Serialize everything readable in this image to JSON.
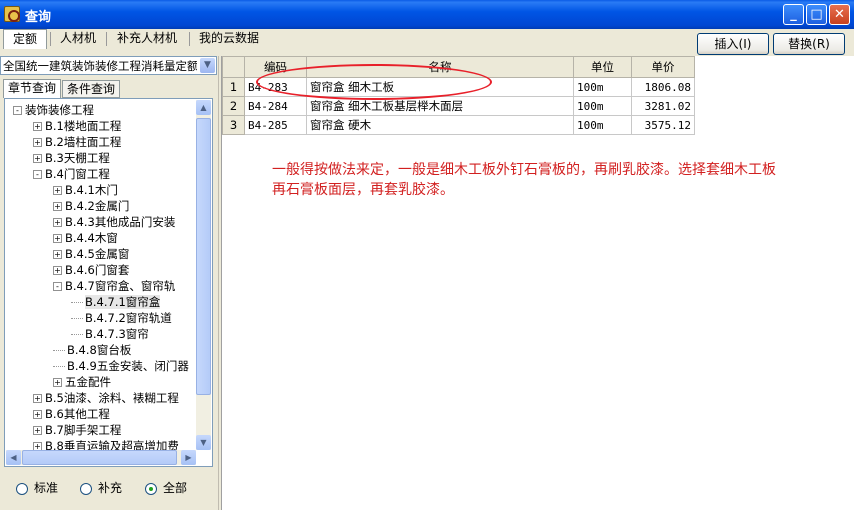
{
  "window": {
    "title": "查询",
    "controls": {
      "minimize": "_",
      "maximize": "□",
      "close": "✕"
    }
  },
  "tabs": [
    "定额",
    "人材机",
    "补充人材机",
    "我的云数据"
  ],
  "buttons": {
    "insert": "插入(I)",
    "replace": "替换(R)"
  },
  "left": {
    "combo_value": "全国统一建筑装饰装修工程消耗量定额",
    "subtabs": [
      "章节查询",
      "条件查询"
    ],
    "tree": [
      {
        "label": "装饰装修工程",
        "level": 0,
        "exp": "-"
      },
      {
        "label": "B.1楼地面工程",
        "level": 1,
        "exp": "+"
      },
      {
        "label": "B.2墙柱面工程",
        "level": 1,
        "exp": "+"
      },
      {
        "label": "B.3天棚工程",
        "level": 1,
        "exp": "+"
      },
      {
        "label": "B.4门窗工程",
        "level": 1,
        "exp": "-"
      },
      {
        "label": "B.4.1木门",
        "level": 2,
        "exp": "+"
      },
      {
        "label": "B.4.2金属门",
        "level": 2,
        "exp": "+"
      },
      {
        "label": "B.4.3其他成品门安装",
        "level": 2,
        "exp": "+"
      },
      {
        "label": "B.4.4木窗",
        "level": 2,
        "exp": "+"
      },
      {
        "label": "B.4.5金属窗",
        "level": 2,
        "exp": "+"
      },
      {
        "label": "B.4.6门窗套",
        "level": 2,
        "exp": "+"
      },
      {
        "label": "B.4.7窗帘盒、窗帘轨",
        "level": 2,
        "exp": "-"
      },
      {
        "label": "B.4.7.1窗帘盒",
        "level": 3,
        "exp": "",
        "selected": true
      },
      {
        "label": "B.4.7.2窗帘轨道",
        "level": 3,
        "exp": ""
      },
      {
        "label": "B.4.7.3窗帘",
        "level": 3,
        "exp": ""
      },
      {
        "label": "B.4.8窗台板",
        "level": 2,
        "exp": ""
      },
      {
        "label": "B.4.9五金安装、闭门器",
        "level": 2,
        "exp": ""
      },
      {
        "label": "五金配件",
        "level": 2,
        "exp": "+"
      },
      {
        "label": "B.5油漆、涂料、裱糊工程",
        "level": 1,
        "exp": "+"
      },
      {
        "label": "B.6其他工程",
        "level": 1,
        "exp": "+"
      },
      {
        "label": "B.7脚手架工程",
        "level": 1,
        "exp": "+"
      },
      {
        "label": "B.8垂直运输及超高增加费",
        "level": 1,
        "exp": "+"
      }
    ],
    "radios": [
      {
        "label": "标准",
        "checked": false
      },
      {
        "label": "补充",
        "checked": false
      },
      {
        "label": "全部",
        "checked": true
      }
    ]
  },
  "grid": {
    "columns": [
      "",
      "编码",
      "名称",
      "单位",
      "单价"
    ],
    "rows": [
      {
        "n": "1",
        "code": "B4-283",
        "name": "窗帘盒 细木工板",
        "unit": "100m",
        "price": "1806.08"
      },
      {
        "n": "2",
        "code": "B4-284",
        "name": "窗帘盒 细木工板基层榉木面层",
        "unit": "100m",
        "price": "3281.02"
      },
      {
        "n": "3",
        "code": "B4-285",
        "name": "窗帘盒 硬木",
        "unit": "100m",
        "price": "3575.12"
      }
    ]
  },
  "annotation": {
    "text": "一般得按做法来定，一般是细木工板外钉石膏板的，再刷乳胶漆。选择套细木工板\n再石膏板面层，再套乳胶漆。",
    "color": "#d22020"
  }
}
